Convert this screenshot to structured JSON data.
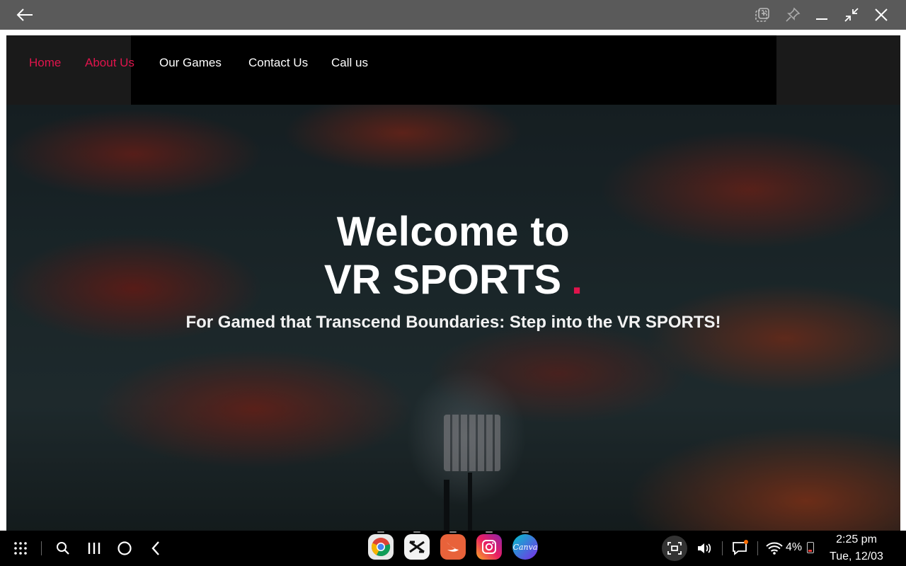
{
  "nav": {
    "items": [
      {
        "label": "Home",
        "active": true
      },
      {
        "label": "About Us",
        "active": true
      },
      {
        "label": "Our Games",
        "active": false
      },
      {
        "label": "Contact Us",
        "active": false
      },
      {
        "label": "Call us",
        "active": false
      }
    ]
  },
  "hero": {
    "title_line1": "Welcome to",
    "title_line2": "VR SPORTS",
    "title_dot": ".",
    "subtitle": "For Gamed that Transcend Boundaries: Step into the VR SPORTS!"
  },
  "window_controls": [
    "back-arrow-icon",
    "window-snap-icon",
    "pin-icon",
    "minimize-icon",
    "exit-fullscreen-icon",
    "close-icon"
  ],
  "taskbar": {
    "apps": [
      "Chrome",
      "CapCut",
      "Swift",
      "Instagram",
      "Canva"
    ],
    "canva_label": "Canva",
    "battery_percent": "4%",
    "time": "2:25 pm",
    "date": "Tue, 12/03"
  },
  "colors": {
    "accent": "#e0144c",
    "titlebar": "#5a5a5a",
    "navbar": "#1a1a1a"
  }
}
